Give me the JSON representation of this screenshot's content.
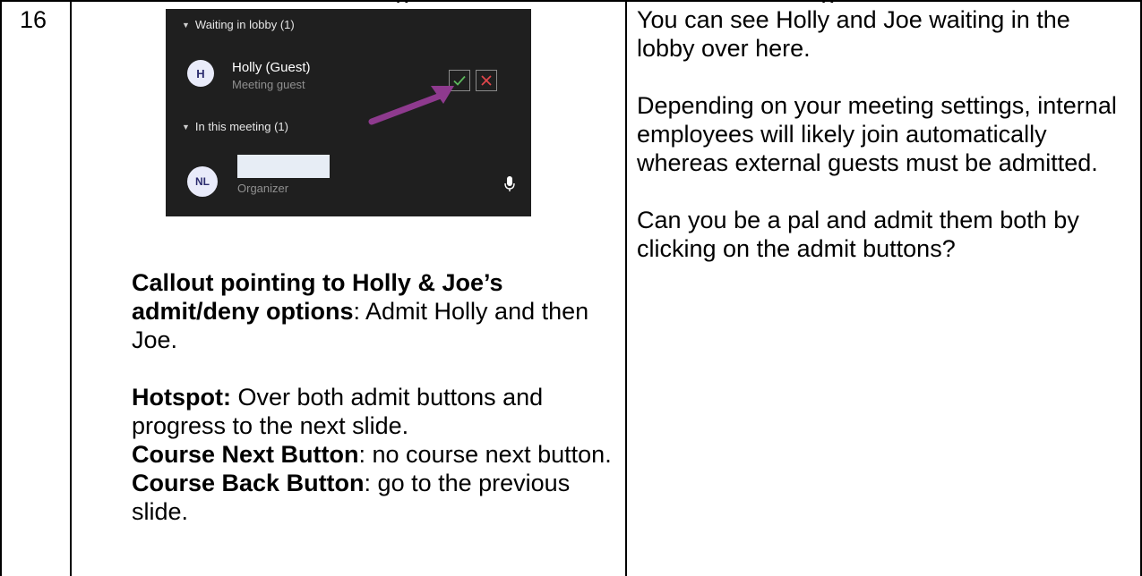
{
  "cut_top_text": [
    "g",
    "g"
  ],
  "row_number": "16",
  "screenshot": {
    "lobby_heading": "Waiting in lobby (1)",
    "guest": {
      "avatar_initial": "H",
      "name": "Holly (Guest)",
      "role": "Meeting guest"
    },
    "meeting_heading": "In this meeting (1)",
    "organizer": {
      "avatar_initials": "NL",
      "role": "Organizer"
    },
    "icons": {
      "admit": "check-icon",
      "deny": "close-icon",
      "mic": "microphone-icon",
      "caret": "caret-down-icon",
      "arrow": "arrow-icon"
    },
    "colors": {
      "background": "#1f1f1f",
      "admit_green": "#5cb85c",
      "deny_red": "#e0464b",
      "arrow_purple": "#8e3a8e",
      "avatar_bg": "#e9ebfa"
    }
  },
  "notes": {
    "callout_label": "Callout pointing to Holly & Joe’s admit/deny options",
    "callout_text": ": Admit Holly and then Joe.",
    "hotspot_label": "Hotspot:",
    "hotspot_text": " Over both admit buttons and progress to the next slide.",
    "next_label": "Course Next Button",
    "next_text": ": no course next button.",
    "back_label": "Course Back Button",
    "back_text": ": go to the previous slide."
  },
  "narration": {
    "p1": "You can see Holly and Joe waiting in the lobby over here.",
    "p2": "Depending on your meeting settings, internal employees will likely join automatically whereas external guests must be admitted.",
    "p3": "Can you be a pal and admit them both by clicking on the admit buttons?"
  }
}
